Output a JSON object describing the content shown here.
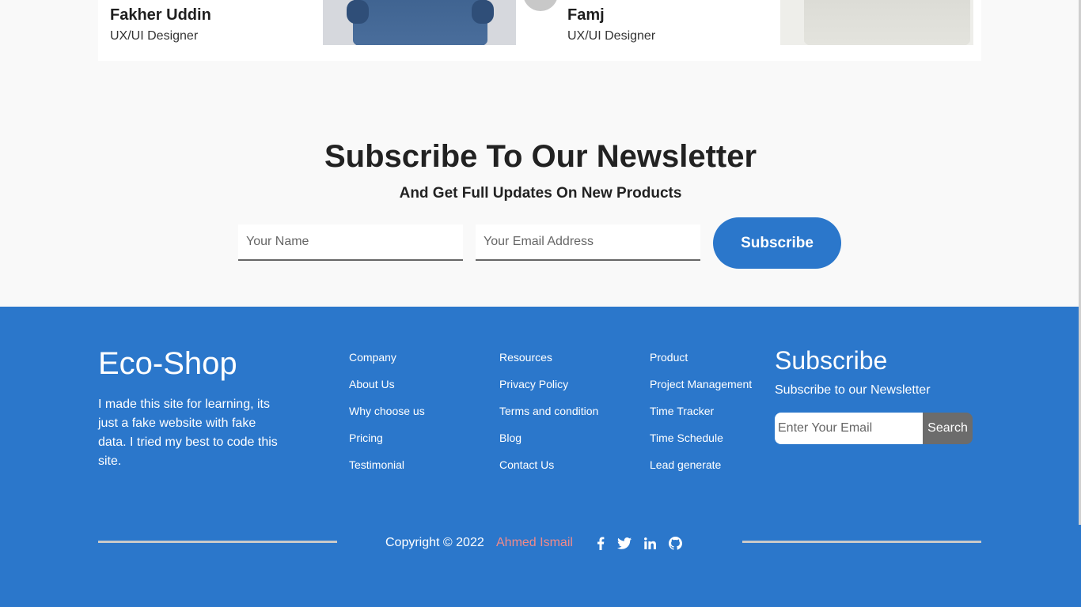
{
  "team": {
    "members": [
      {
        "name": "Fakher Uddin",
        "role": "UX/UI Designer"
      },
      {
        "name": "Famj",
        "role": "UX/UI Designer"
      }
    ]
  },
  "newsletter": {
    "title": "Subscribe To Our Newsletter",
    "subtitle": "And Get Full Updates On New Products",
    "name_placeholder": "Your Name",
    "email_placeholder": "Your Email Address",
    "button_label": "Subscribe"
  },
  "footer": {
    "brand": "Eco-Shop",
    "about": "I made this site for learning, its just a fake website with fake data. I tried my best to code this site.",
    "columns": [
      {
        "items": [
          "Company",
          "About Us",
          "Why choose us",
          "Pricing",
          "Testimonial"
        ]
      },
      {
        "items": [
          "Resources",
          "Privacy Policy",
          "Terms and condition",
          "Blog",
          "Contact Us"
        ]
      },
      {
        "items": [
          "Product",
          "Project Management",
          "Time Tracker",
          "Time Schedule",
          "Lead generate"
        ]
      }
    ],
    "subscribe": {
      "title": "Subscribe",
      "text": "Subscribe to our Newsletter",
      "placeholder": "Enter Your Email",
      "button_label": "Search"
    },
    "copyright": "Copyright © 2022",
    "author": "Ahmed Ismail",
    "social_icons": [
      "facebook-icon",
      "twitter-icon",
      "linkedin-icon",
      "github-icon"
    ]
  },
  "colors": {
    "primary": "#2b77cb",
    "author_link": "#f08a8a",
    "search_button": "#6c6c6c"
  }
}
